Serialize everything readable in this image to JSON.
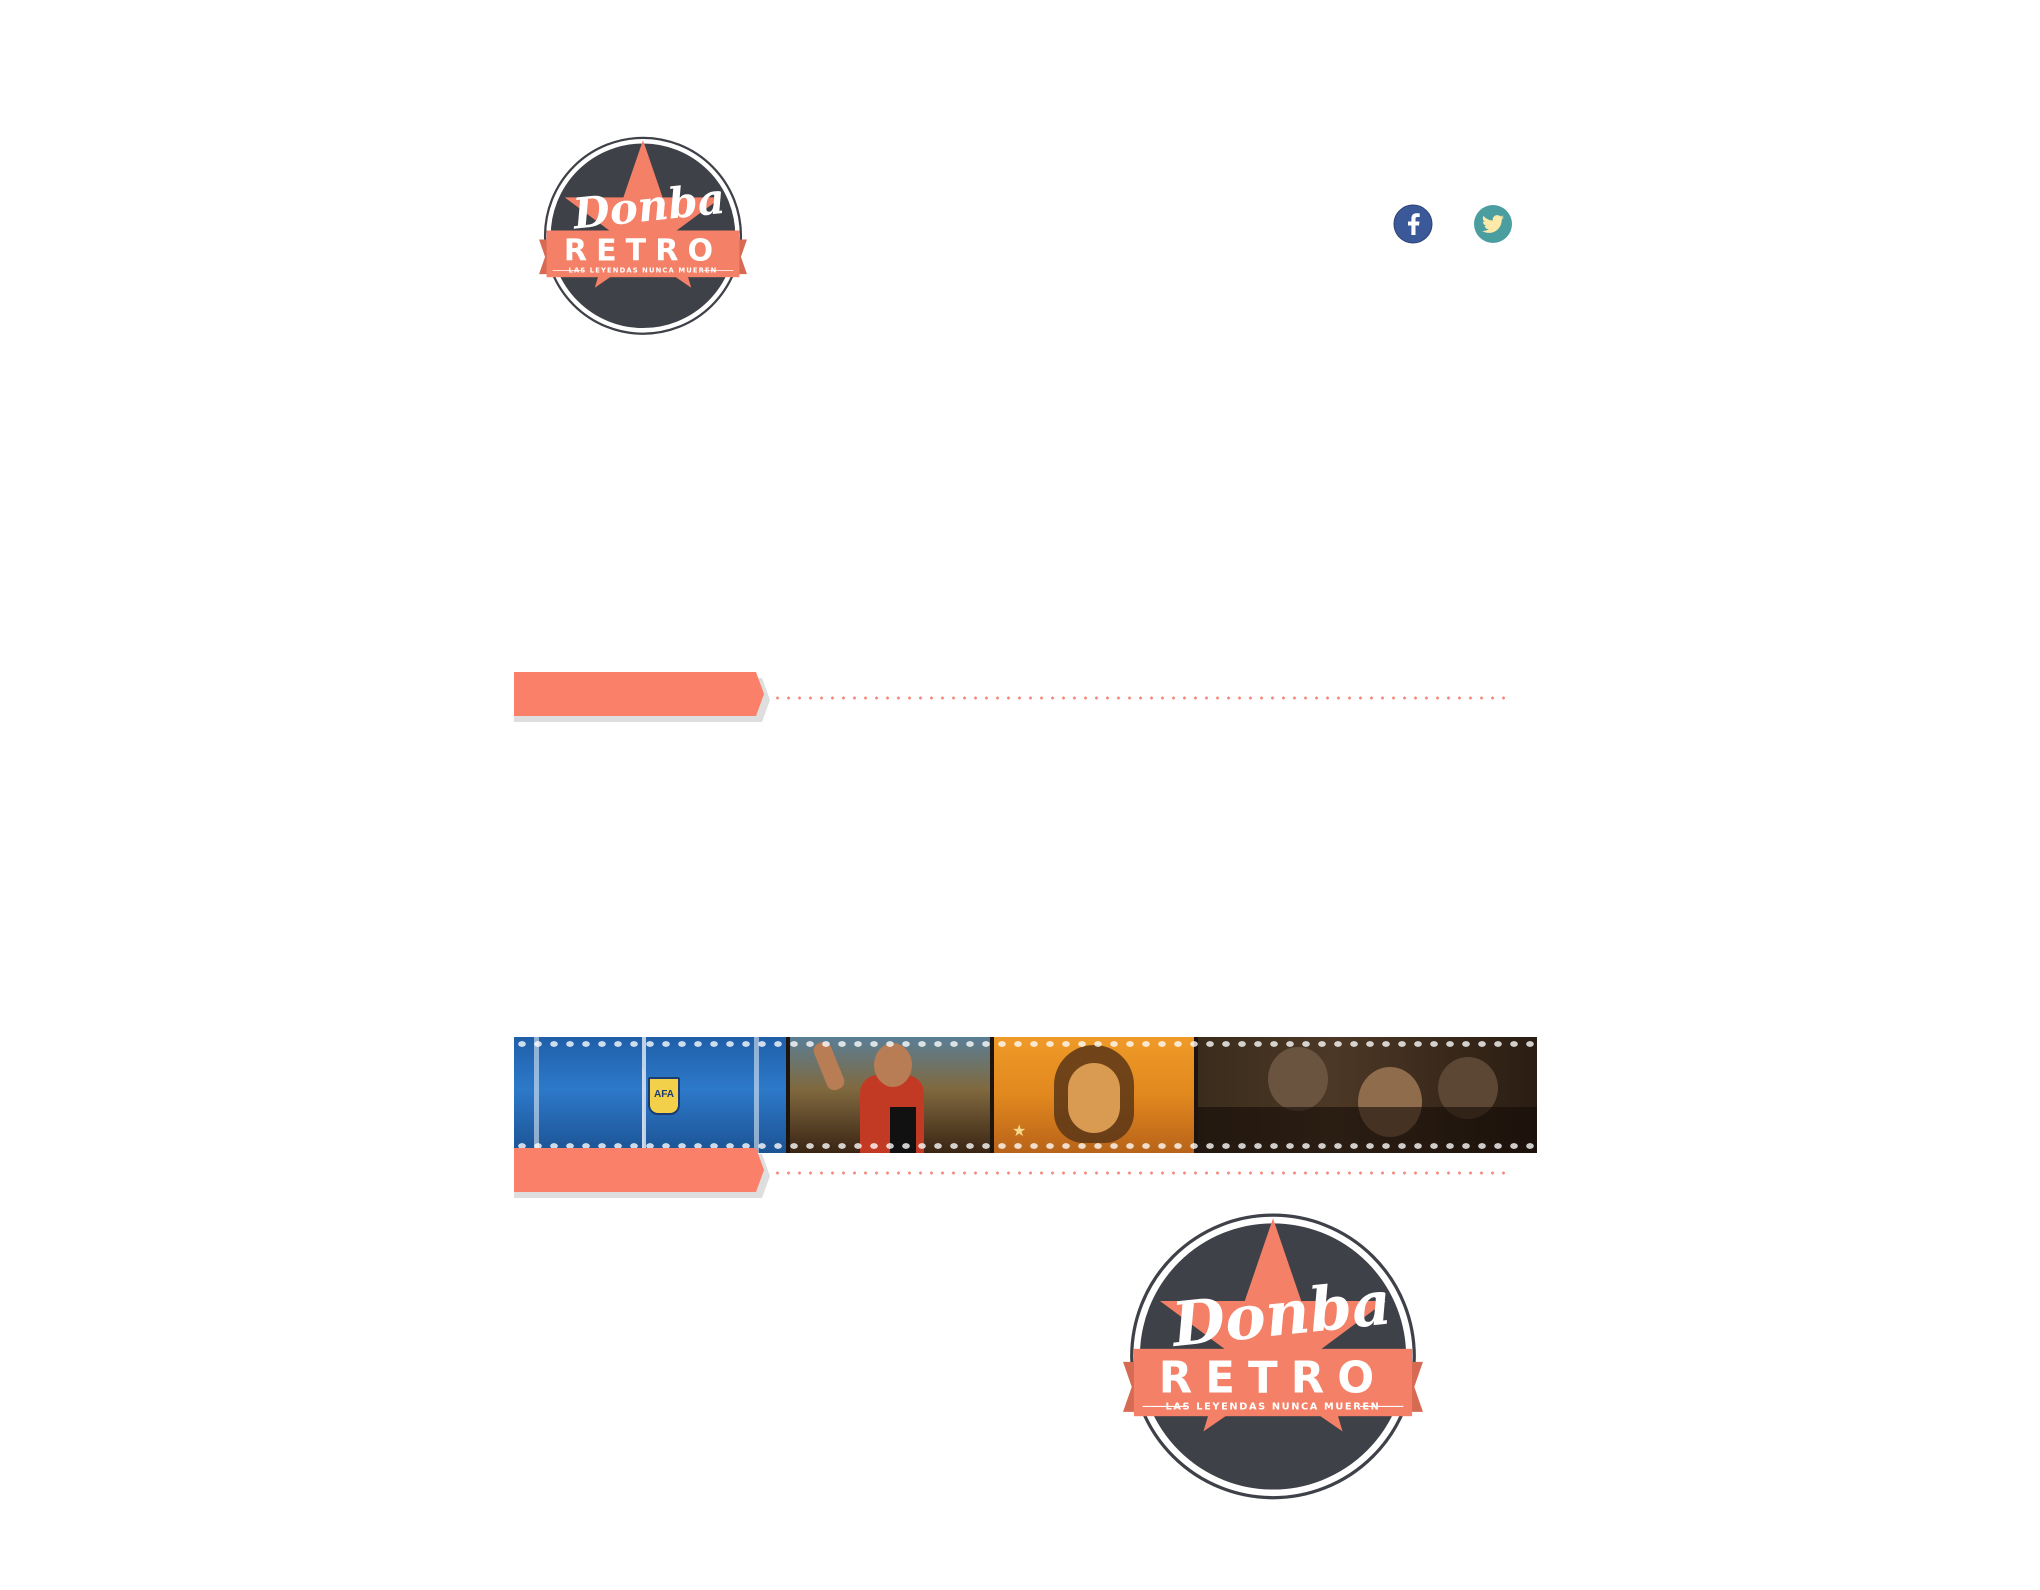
{
  "brand": {
    "script": "Donba",
    "title": "RETRO",
    "tagline": "LAS LEYENDAS NUNCA MUEREN"
  },
  "social": {
    "items": [
      {
        "name": "facebook",
        "icon": "facebook-icon",
        "color": "#3b5998"
      },
      {
        "name": "twitter",
        "icon": "twitter-icon",
        "color": "#4a9ea0"
      }
    ]
  },
  "colors": {
    "accent": "#fa8069",
    "logo_dark": "#3f4148",
    "logo_star": "#f48067",
    "dots": "#f58a78"
  },
  "filmstrip": {
    "frames": [
      {
        "name": "frame-blue-jacket-afa",
        "badge": "AFA"
      },
      {
        "name": "frame-player-fist-raised"
      },
      {
        "name": "frame-mural-portrait"
      },
      {
        "name": "frame-group-scene"
      }
    ]
  }
}
